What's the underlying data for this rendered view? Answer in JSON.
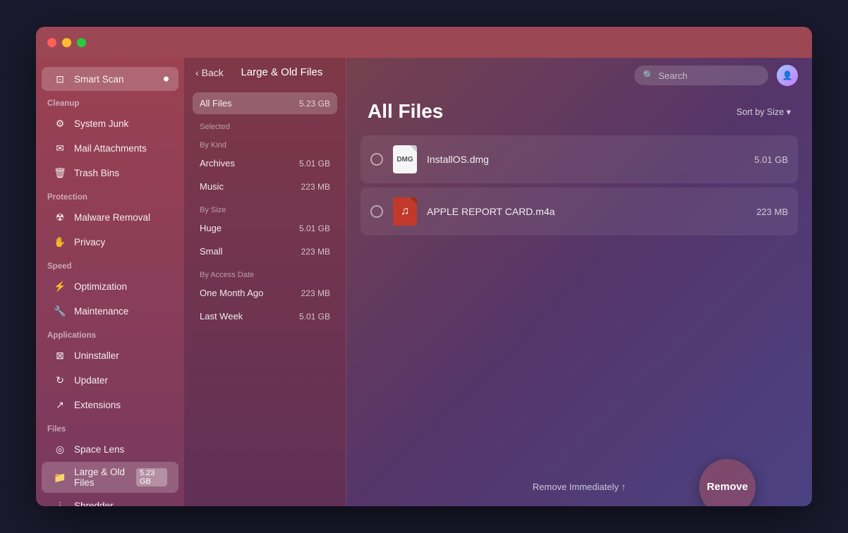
{
  "window": {
    "title": "Large & Old Files"
  },
  "sidebar": {
    "sections": [
      {
        "label": "",
        "items": [
          {
            "id": "smart-scan",
            "label": "Smart Scan",
            "icon": "⊡",
            "active": true,
            "badge": "•"
          }
        ]
      },
      {
        "label": "Cleanup",
        "items": [
          {
            "id": "system-junk",
            "label": "System Junk",
            "icon": "⚙"
          },
          {
            "id": "mail-attachments",
            "label": "Mail Attachments",
            "icon": "✉"
          },
          {
            "id": "trash-bins",
            "label": "Trash Bins",
            "icon": "🗑"
          }
        ]
      },
      {
        "label": "Protection",
        "items": [
          {
            "id": "malware-removal",
            "label": "Malware Removal",
            "icon": "☢"
          },
          {
            "id": "privacy",
            "label": "Privacy",
            "icon": "✋"
          }
        ]
      },
      {
        "label": "Speed",
        "items": [
          {
            "id": "optimization",
            "label": "Optimization",
            "icon": "⚡"
          },
          {
            "id": "maintenance",
            "label": "Maintenance",
            "icon": "🔧"
          }
        ]
      },
      {
        "label": "Applications",
        "items": [
          {
            "id": "uninstaller",
            "label": "Uninstaller",
            "icon": "⊠"
          },
          {
            "id": "updater",
            "label": "Updater",
            "icon": "↻"
          },
          {
            "id": "extensions",
            "label": "Extensions",
            "icon": "↗"
          }
        ]
      },
      {
        "label": "Files",
        "items": [
          {
            "id": "space-lens",
            "label": "Space Lens",
            "icon": "◎"
          },
          {
            "id": "large-old-files",
            "label": "Large & Old Files",
            "icon": "📁",
            "badge": "5.23 GB",
            "active_nav": true
          },
          {
            "id": "shredder",
            "label": "Shredder",
            "icon": "⫶"
          }
        ]
      }
    ]
  },
  "middle_panel": {
    "back_label": "Back",
    "title": "Large & Old Files",
    "filter_selected_label": "Selected",
    "filters": {
      "all": {
        "label": "All Files",
        "size": "5.23 GB",
        "active": true
      },
      "by_kind": {
        "section_label": "By Kind",
        "items": [
          {
            "label": "Archives",
            "size": "5.01 GB"
          },
          {
            "label": "Music",
            "size": "223 MB"
          }
        ]
      },
      "by_size": {
        "section_label": "By Size",
        "items": [
          {
            "label": "Huge",
            "size": "5.01 GB"
          },
          {
            "label": "Small",
            "size": "223 MB"
          }
        ]
      },
      "by_access_date": {
        "section_label": "By Access Date",
        "items": [
          {
            "label": "One Month Ago",
            "size": "223 MB"
          },
          {
            "label": "Last Week",
            "size": "5.01 GB"
          }
        ]
      }
    }
  },
  "main": {
    "title": "All Files",
    "search_placeholder": "Search",
    "sort_label": "Sort by Size ▾",
    "files": [
      {
        "id": "file-1",
        "name": "InstallOS.dmg",
        "size": "5.01 GB",
        "type": "dmg"
      },
      {
        "id": "file-2",
        "name": "APPLE REPORT CARD.m4a",
        "size": "223 MB",
        "type": "m4a"
      }
    ],
    "remove_immediately_label": "Remove Immediately ↑",
    "remove_button_label": "Remove"
  }
}
